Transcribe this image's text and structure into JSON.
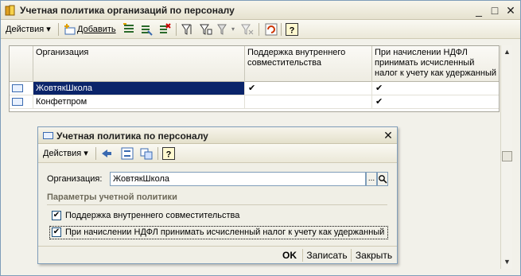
{
  "window": {
    "title": "Учетная политика организаций по персоналу",
    "minimize": "_",
    "maximize": "□",
    "close": "✕"
  },
  "toolbar": {
    "actions_label": "Действия",
    "add_label": "Добавить"
  },
  "table": {
    "columns": [
      "Организация",
      "Поддержка внутреннего совместительства",
      "При начислении НДФЛ принимать исчисленный налог к учету как удержанный"
    ],
    "rows": [
      {
        "organization": "ЖовтякШкола",
        "internal_combination": "✔",
        "ndfl_as_withheld": "✔",
        "selected": true
      },
      {
        "organization": "Конфетпром",
        "internal_combination": "",
        "ndfl_as_withheld": "✔",
        "selected": false
      }
    ]
  },
  "dialog": {
    "title": "Учетная политика по персоналу",
    "actions_label": "Действия",
    "organization_label": "Организация:",
    "organization_value": "ЖовтякШкола",
    "select_button": "...",
    "search_button": "🔍",
    "group_title": "Параметры учетной политики",
    "checkbox_internal": {
      "label": "Поддержка внутреннего совместительства",
      "checked": true
    },
    "checkbox_ndfl": {
      "label": "При начислении НДФЛ принимать исчисленный налог к учету как удержанный",
      "checked": true
    },
    "ok_label": "OK",
    "save_label": "Записать",
    "close_label": "Закрыть",
    "close_icon": "✕"
  },
  "colors": {
    "selection": "#0a246a",
    "window_bg": "#f2f1ea",
    "frame": "#7f9db9"
  }
}
